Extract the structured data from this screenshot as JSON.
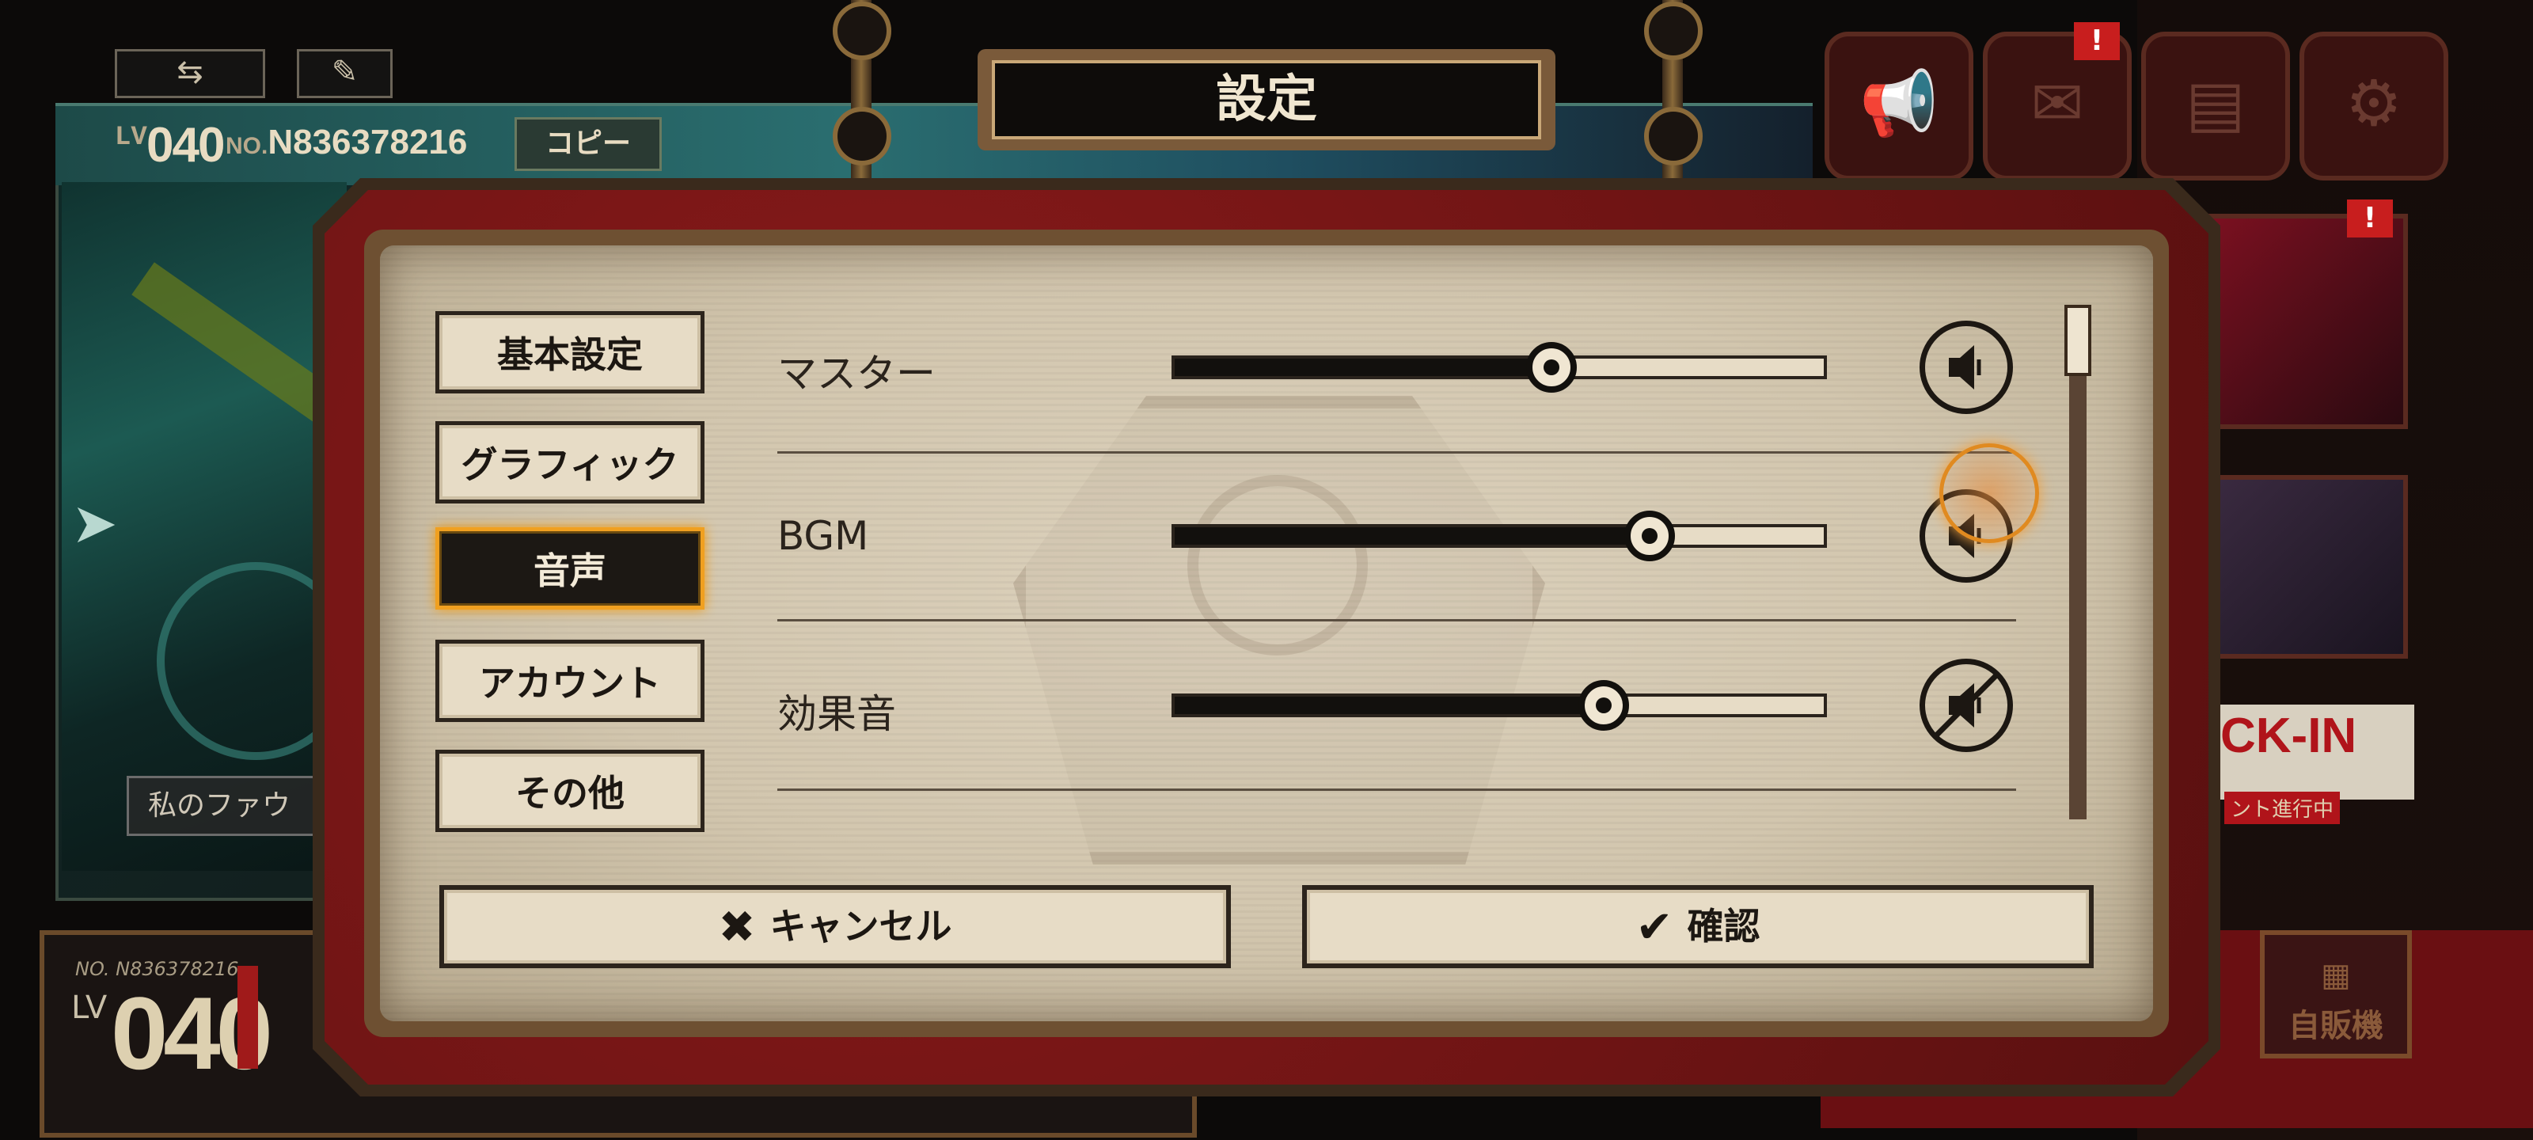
{
  "hud": {
    "lv_prefix": "LV",
    "lv_value": "040",
    "no_prefix": "NO.",
    "player_id": "N836378216",
    "copy_label": "コピー",
    "swap_icon": "swap-arrows-icon",
    "brush_icon": "brush-icon",
    "my_favorite_label": "私のファウ",
    "bottom_no": "NO. N836378216",
    "bottom_lv_prefix": "LV",
    "bottom_lv_value": "040",
    "checkin_text": "CK-IN",
    "checkin_sub": "ント進行中",
    "vending_label": "自販機",
    "badge_mark": "!"
  },
  "dialog": {
    "title": "設定",
    "tabs": [
      {
        "label": "基本設定",
        "active": false
      },
      {
        "label": "グラフィック",
        "active": false
      },
      {
        "label": "音声",
        "active": true
      },
      {
        "label": "アカウント",
        "active": false
      },
      {
        "label": "その他",
        "active": false
      }
    ],
    "volume_rows": [
      {
        "label": "マスター",
        "level": 0.58,
        "muted": false
      },
      {
        "label": "BGM",
        "level": 0.73,
        "muted": false
      },
      {
        "label": "効果音",
        "level": 0.66,
        "muted": true
      }
    ],
    "cancel_label": "キャンセル",
    "confirm_label": "確認",
    "cancel_icon": "x-icon",
    "confirm_icon": "checkmark-icon"
  },
  "colors": {
    "paper": "#d6cab3",
    "frame": "#6e5032",
    "red_frame": "#6e1414",
    "active_tab_border": "#f0a020",
    "ink": "#12100d"
  }
}
